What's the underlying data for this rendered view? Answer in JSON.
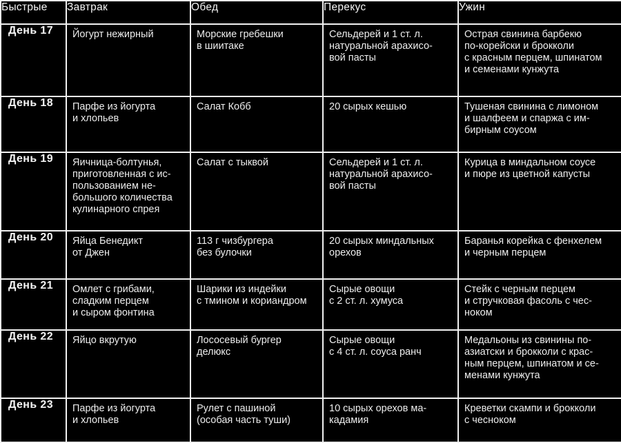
{
  "table": {
    "headers": [
      "Быстрые",
      "Завтрак",
      "Обед",
      "Перекус",
      "Ужин"
    ],
    "rows": [
      {
        "day": "День 17",
        "breakfast": "Йогурт нежирный",
        "lunch": "Морские гребешки\nв шиитаке",
        "snack": "Сельдерей и 1 ст. л.\nнатуральной арахисо-\nвой пасты",
        "dinner": "Острая свинина барбекю\nпо-корейски и брокколи\nс красным перцем, шпинатом\nи семенами кунжута"
      },
      {
        "day": "День 18",
        "breakfast": "Парфе из йогурта\nи хлопьев",
        "lunch": "Салат Кобб",
        "snack": "20 сырых кешью",
        "dinner": "Тушеная свинина с лимоном\nи шалфеем и спаржа с им-\nбирным соусом"
      },
      {
        "day": "День 19",
        "breakfast": "Яичница-болтунья,\nприготовленная с ис-\nпользованием не-\nбольшого количества\nкулинарного спрея",
        "lunch": "Салат с тыквой",
        "snack": "Сельдерей и 1 ст. л.\nнатуральной арахисо-\nвой пасты",
        "dinner": "Курица в миндальном соусе\nи пюре из цветной капусты"
      },
      {
        "day": "День 20",
        "breakfast": "Яйца Бенедикт\nот Джен",
        "lunch": "113 г чизбургера\nбез булочки",
        "snack": "20 сырых миндальных\nорехов",
        "dinner": "Баранья корейка с фенхелем\nи черным перцем"
      },
      {
        "day": "День 21",
        "breakfast": "Омлет с грибами,\nсладким перцем\nи сыром фонтина",
        "lunch": "Шарики из индейки\nс тмином и кориандром",
        "snack": "Сырые овощи\nс 2 ст. л. хумуса",
        "dinner": "Стейк с черным перцем\nи стручковая фасоль с чес-\nноком"
      },
      {
        "day": "День 22",
        "breakfast": "Яйцо вкрутую",
        "lunch": "Лососевый бургер\nделюкс",
        "snack": "Сырые овощи\nс 4 ст. л. соуса ранч",
        "dinner": "Медальоны из свинины по-\nазиатски и брокколи с крас-\nным перцем, шпинатом и се-\nменами кунжута"
      },
      {
        "day": "День 23",
        "breakfast": "Парфе из йогурта\nи хлопьев",
        "lunch": "Рулет с пашиной\n(особая часть туши)",
        "snack": "10 сырых орехов ма-\nкадамия",
        "dinner": "Креветки скампи и брокколи\nс чесноком"
      }
    ]
  },
  "colors": {
    "background": "#000000",
    "text": "#ededed",
    "border": "#f2f2f2"
  }
}
